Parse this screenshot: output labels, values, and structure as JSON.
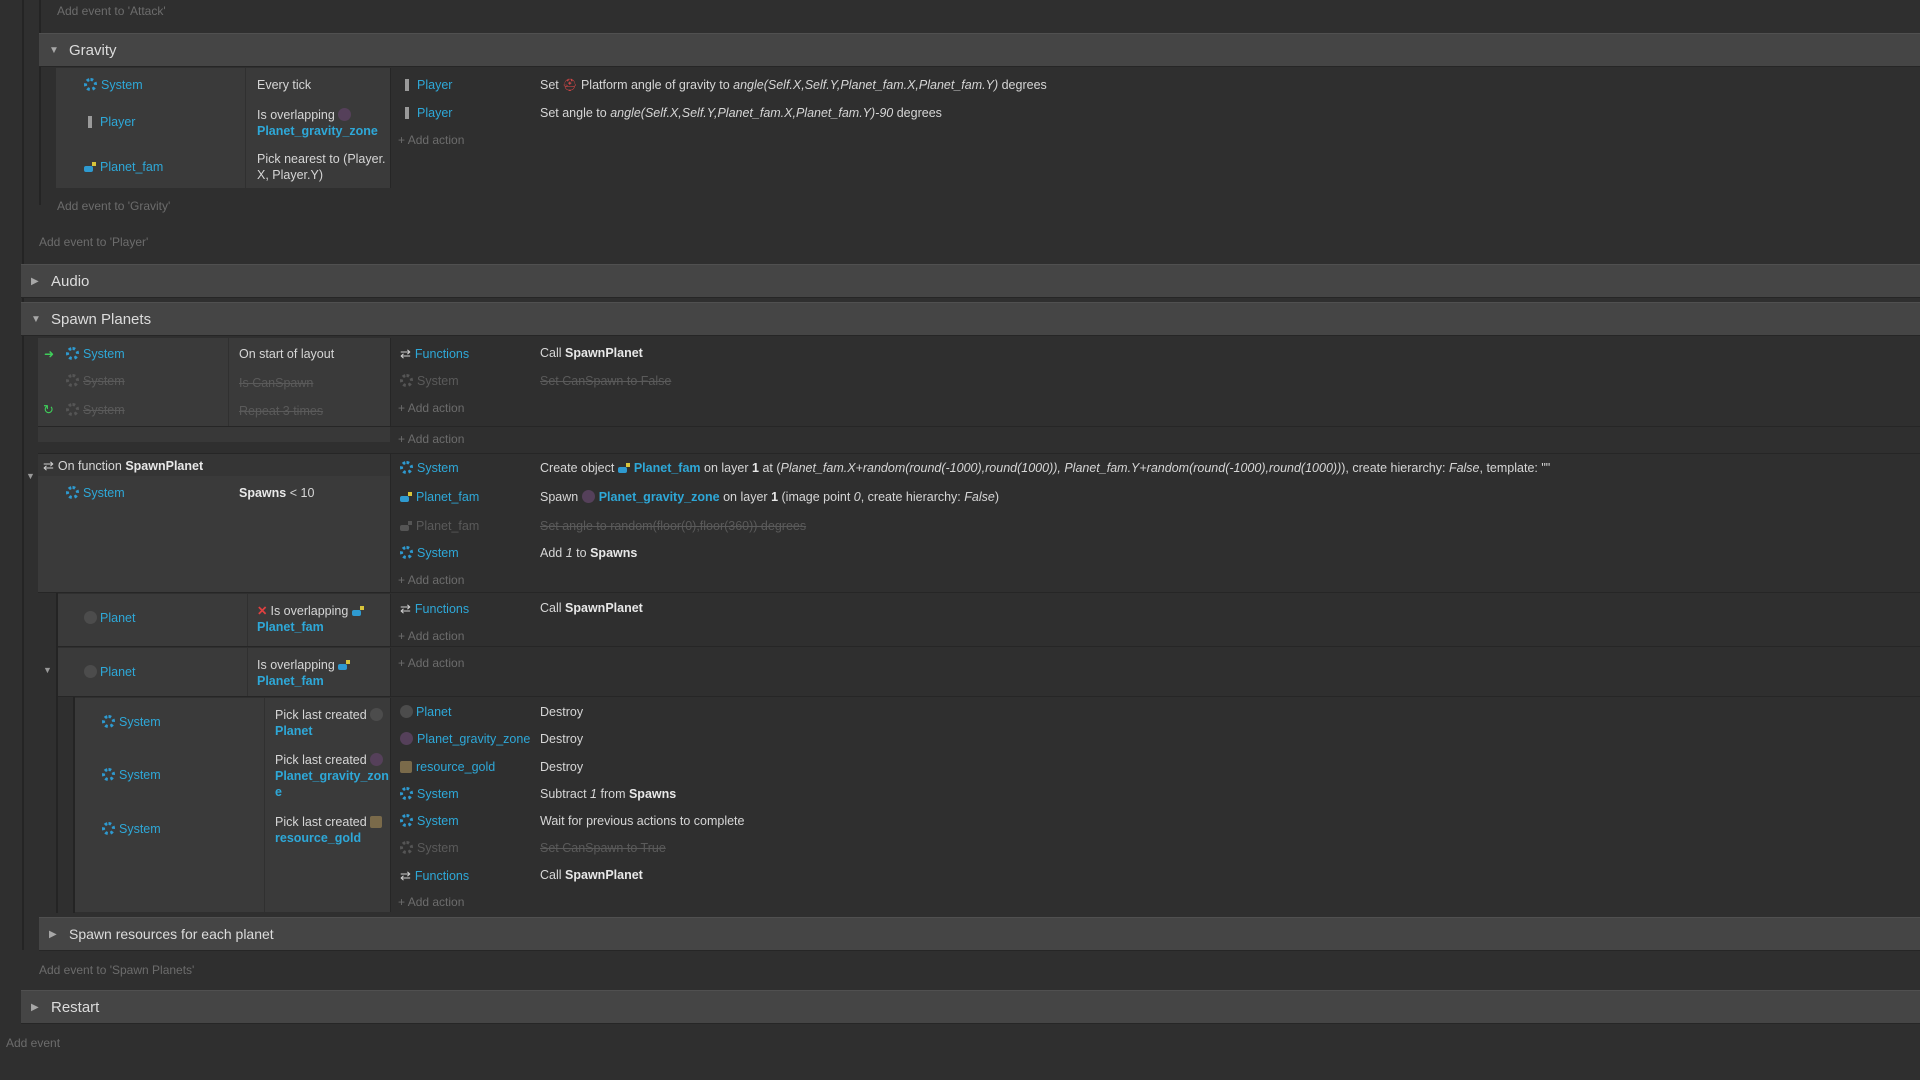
{
  "add_event_attack": "Add event to 'Attack'",
  "gravity": {
    "title": "Gravity",
    "conditions": [
      {
        "object": "System",
        "text": "Every tick"
      },
      {
        "object": "Player",
        "text": "Is overlapping",
        "param": "Planet_gravity_zone"
      },
      {
        "object": "Planet_fam",
        "text_line1": "Pick nearest to (Player.",
        "text_line2": "X, Player.Y)"
      }
    ],
    "actions": [
      {
        "object": "Player",
        "pre": "Set",
        "mid": "Platform angle of gravity to",
        "expr": "angle(Self.X,Self.Y,Planet_fam.X,Planet_fam.Y)",
        "post": "degrees"
      },
      {
        "object": "Player",
        "pre": "Set angle to",
        "expr": "angle(Self.X,Self.Y,Planet_fam.X,Planet_fam.Y)-90",
        "post": "degrees"
      }
    ],
    "add_action": "Add action",
    "add_event": "Add event to 'Gravity'"
  },
  "add_event_player": "Add event to 'Player'",
  "audio": {
    "title": "Audio"
  },
  "spawn_planets": {
    "title": "Spawn Planets",
    "ev1": {
      "conditions": [
        {
          "object": "System",
          "text": "On start of layout"
        },
        {
          "object": "System",
          "text": "Is CanSpawn"
        },
        {
          "object": "System",
          "text": "Repeat 3 times"
        }
      ],
      "actions": [
        {
          "object": "Functions",
          "pre": "Call",
          "name": "SpawnPlanet"
        },
        {
          "object": "System",
          "text": "Set CanSpawn to False"
        }
      ]
    },
    "ev_function": {
      "header_pre": "On function",
      "header_name": "SpawnPlanet",
      "cond": {
        "object": "System",
        "text_pre": "Spawns",
        "text_post": "< 10"
      },
      "actions": [
        {
          "object": "System",
          "pre": "Create object",
          "obj": "Planet_fam",
          "mid1": "on layer",
          "layer": "1",
          "mid2": "at (",
          "expr": "Planet_fam.X+random(round(-1000),round(1000)), Planet_fam.Y+random(round(-1000),round(1000))",
          "mid3": "), create hierarchy:",
          "hier": "False",
          "mid4": ", template: \"\""
        },
        {
          "object": "Planet_fam",
          "pre": "Spawn",
          "obj": "Planet_gravity_zone",
          "mid1": "on layer",
          "layer": "1",
          "mid2": "(image point",
          "pt": "0",
          "mid3": ", create hierarchy:",
          "hier": "False",
          "mid4": ")"
        },
        {
          "object": "Planet_fam",
          "text": "Set angle to random(floor(0),floor(360)) degrees"
        },
        {
          "object": "System",
          "pre": "Add",
          "num": "1",
          "mid": "to",
          "var": "Spawns"
        }
      ]
    },
    "ev_planet_not": {
      "object": "Planet",
      "text": "Is overlapping",
      "param": "Planet_fam",
      "action": {
        "object": "Functions",
        "pre": "Call",
        "name": "SpawnPlanet"
      }
    },
    "ev_planet_over": {
      "object": "Planet",
      "text": "Is overlapping",
      "param": "Planet_fam"
    },
    "sub": {
      "conditions": [
        {
          "object": "System",
          "text": "Pick last created",
          "param": "Planet"
        },
        {
          "object": "System",
          "text": "Pick last created",
          "param_l1": "Planet_gravity_zon",
          "param_l2": "e"
        },
        {
          "object": "System",
          "text": "Pick last created",
          "param": "resource_gold"
        }
      ],
      "actions": [
        {
          "object": "Planet",
          "text": "Destroy"
        },
        {
          "object": "Planet_gravity_zone",
          "text": "Destroy"
        },
        {
          "object": "resource_gold",
          "text": "Destroy"
        },
        {
          "object": "System",
          "pre": "Subtract",
          "num": "1",
          "mid": "from",
          "var": "Spawns"
        },
        {
          "object": "System",
          "text": "Wait for previous actions to complete"
        },
        {
          "object": "System",
          "text": "Set CanSpawn to True"
        },
        {
          "object": "Functions",
          "pre": "Call",
          "name": "SpawnPlanet"
        }
      ]
    },
    "resources_group": "Spawn resources for each planet",
    "add_event": "Add event to 'Spawn Planets'"
  },
  "restart": {
    "title": "Restart"
  },
  "add_event": "Add event"
}
